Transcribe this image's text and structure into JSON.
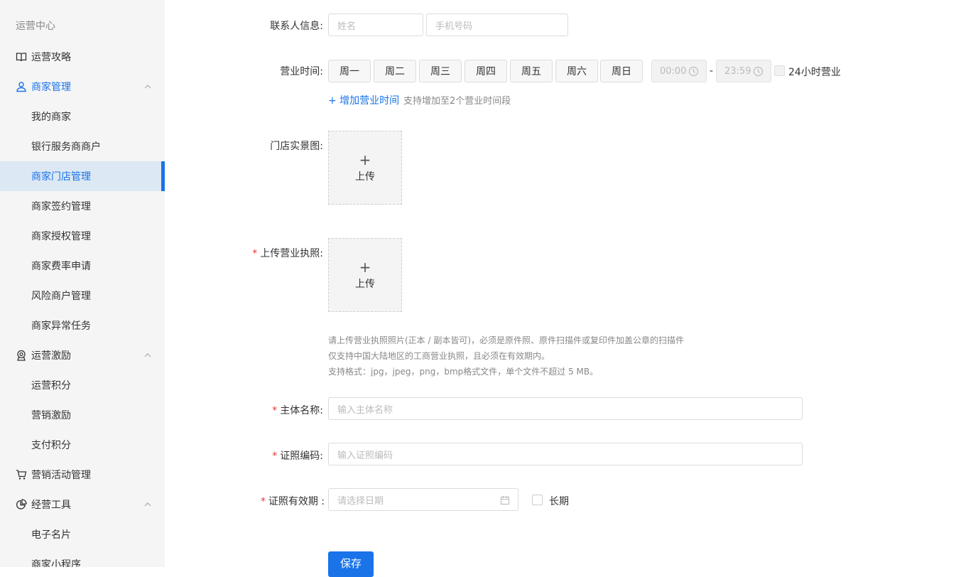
{
  "sidebar": {
    "title": "运营中心",
    "items": [
      {
        "label": "运营攻略"
      },
      {
        "label": "商家管理"
      },
      {
        "label": "我的商家"
      },
      {
        "label": "银行服务商商户"
      },
      {
        "label": "商家门店管理"
      },
      {
        "label": "商家签约管理"
      },
      {
        "label": "商家授权管理"
      },
      {
        "label": "商家费率申请"
      },
      {
        "label": "风险商户管理"
      },
      {
        "label": "商家异常任务"
      },
      {
        "label": "运营激励"
      },
      {
        "label": "运营积分"
      },
      {
        "label": "营销激励"
      },
      {
        "label": "支付积分"
      },
      {
        "label": "营销活动管理"
      },
      {
        "label": "经营工具"
      },
      {
        "label": "电子名片"
      },
      {
        "label": "商家小程序"
      }
    ]
  },
  "form": {
    "contact": {
      "label": "联系人信息:",
      "name_placeholder": "姓名",
      "phone_placeholder": "手机号码"
    },
    "hours": {
      "label": "营业时间:",
      "days": [
        "周一",
        "周二",
        "周三",
        "周四",
        "周五",
        "周六",
        "周日"
      ],
      "start": "00:00",
      "separator": "-",
      "end": "23:59",
      "all_day_label": "24小时营业",
      "add_link": "+ 增加营业时间",
      "add_hint": "支持增加至2个营业时间段"
    },
    "store_photo": {
      "label": "门店实景图:",
      "plus": "+",
      "upload": "上传"
    },
    "license": {
      "required": "*",
      "label": "上传营业执照:",
      "plus": "+",
      "upload": "上传",
      "hints": [
        "请上传营业执照照片(正本 / 副本皆可)，必须是原件照、原件扫描件或复印件加盖公章的扫描件",
        "仅支持中国大陆地区的工商营业执照，且必须在有效期内。",
        "支持格式：jpg，jpeg，png，bmp格式文件，单个文件不超过 5 MB。"
      ]
    },
    "entity_name": {
      "required": "*",
      "label": "主体名称:",
      "placeholder": "输入主体名称"
    },
    "cert_code": {
      "required": "*",
      "label": "证照编码:",
      "placeholder": "输入证照编码"
    },
    "validity": {
      "required": "*",
      "label": "证照有效期 :",
      "placeholder": "请选择日期",
      "long_term_label": "长期"
    },
    "save_label": "保存"
  },
  "colors": {
    "accent": "#1a73e8",
    "required": "#e53935",
    "sidebar_bg": "#f5f5f5",
    "active_bg": "#dce8f4"
  }
}
